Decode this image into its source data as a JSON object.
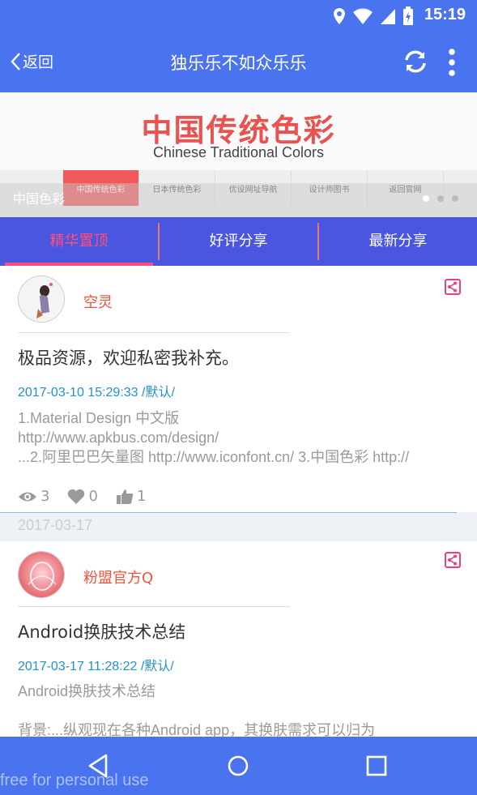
{
  "status_bar": {
    "time": "15:19"
  },
  "appbar": {
    "back_label": "返回",
    "title": "独乐乐不如众乐乐"
  },
  "banner": {
    "title": "中国传统色彩",
    "subtitle": "Chinese Traditional Colors",
    "nav_items": [
      "中国传统色彩",
      "日本传统色彩",
      "优设网址导航",
      "设计师图书",
      "返回官网"
    ],
    "caption": "中国色彩"
  },
  "tabs": [
    {
      "label": "精华置顶"
    },
    {
      "label": "好评分享"
    },
    {
      "label": "最新分享"
    }
  ],
  "posts": [
    {
      "author": "空灵",
      "title": "极品资源，欢迎私密我补充。",
      "meta": "2017-03-10 15:29:33  /默认/",
      "body": [
        "1.Material Design 中文版",
        "http://www.apkbus.com/design/",
        "...2.阿里巴巴矢量图 http://www.iconfont.cn/  3.中国色彩 http://"
      ],
      "views": "3",
      "likes": "0",
      "thumbs": "1"
    },
    {
      "author": "粉盟官方Q",
      "title": "Android换肤技术总结",
      "meta": "2017-03-17 11:28:22  /默认/",
      "body": [
        "Android换肤技术总结",
        "",
        "背景:...纵观现在各种Android app，其换肤需求可以归为"
      ]
    }
  ],
  "date_separator": "2017-03-17",
  "watermark": "free for personal use",
  "colors": {
    "primary": "#4a73f0",
    "tab_bar": "#4a56e0",
    "accent_pink": "#ff4f7a",
    "author_red": "#f0533c",
    "meta_blue": "#1f93c9"
  }
}
